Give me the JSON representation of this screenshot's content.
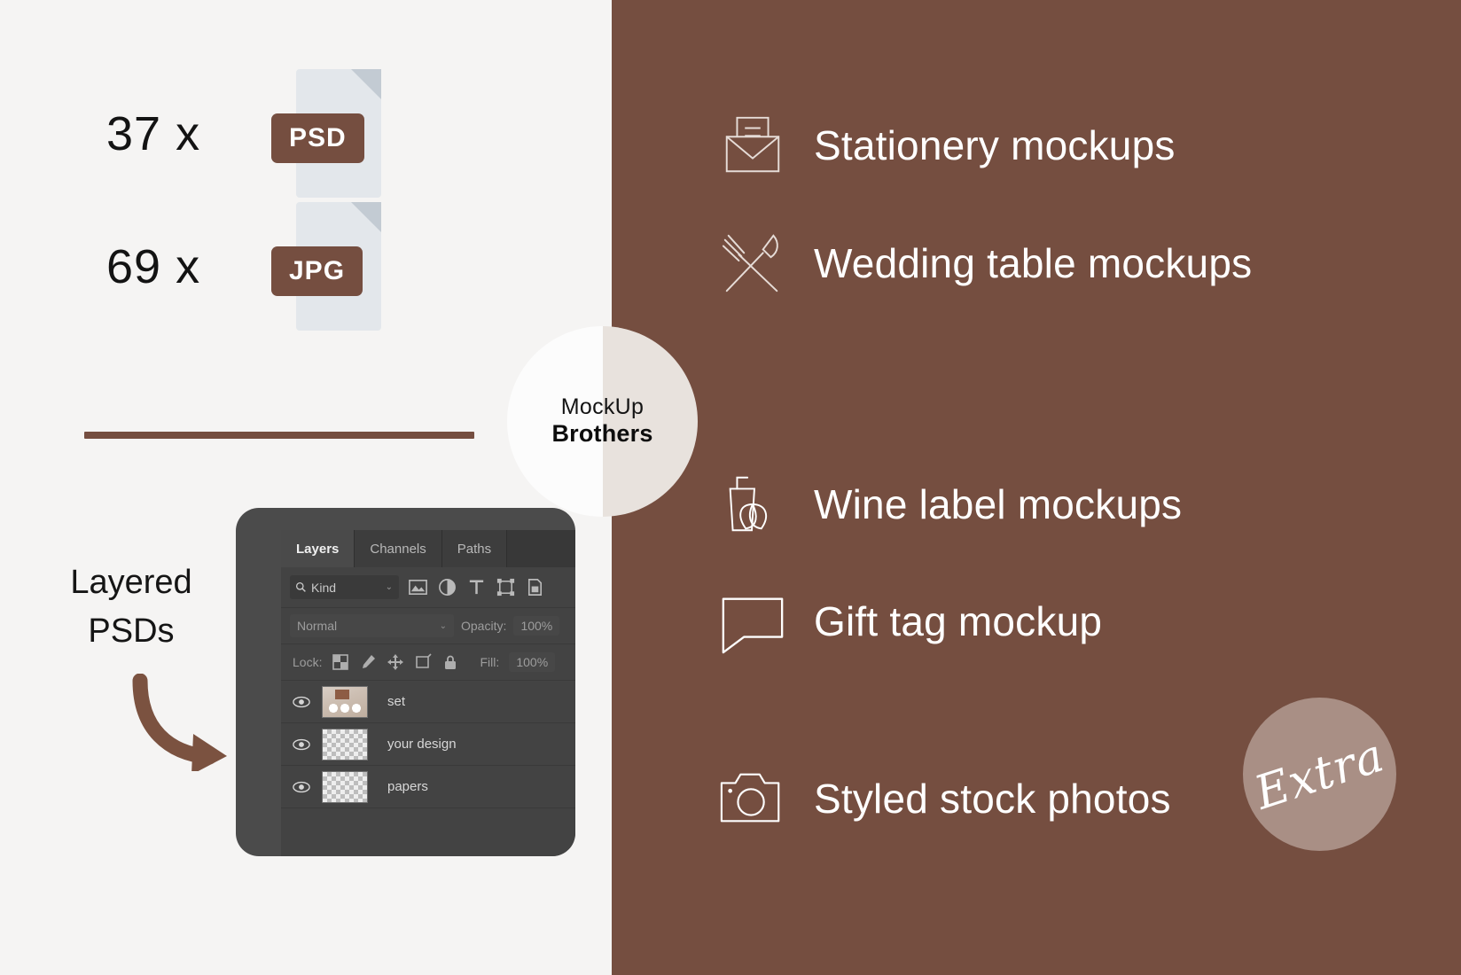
{
  "brand": {
    "line1": "MockUp",
    "line2": "Brothers"
  },
  "colors": {
    "brown": "#754e40",
    "panel_bg": "#f5f4f3",
    "badge_mauve": "#a98f85",
    "white": "#ffffff"
  },
  "left": {
    "file_types": [
      {
        "count": "37 x",
        "format": "PSD",
        "icon": "psd-file-icon"
      },
      {
        "count": "69 x",
        "format": "JPG",
        "icon": "jpg-file-icon"
      }
    ],
    "layered_label_line1": "Layered",
    "layered_label_line2": "PSDs",
    "arrow_icon": "curved-arrow-icon"
  },
  "photoshop": {
    "tabs": [
      {
        "label": "Layers",
        "active": true
      },
      {
        "label": "Channels",
        "active": false
      },
      {
        "label": "Paths",
        "active": false
      }
    ],
    "filter": {
      "kind_label": "Kind",
      "search_icon": "search-icon",
      "chevron": "⌄",
      "filter_icons": [
        "pixel-layer-filter-icon",
        "adjustment-layer-filter-icon",
        "type-layer-filter-icon",
        "shape-layer-filter-icon",
        "smart-object-filter-icon"
      ]
    },
    "blend": {
      "mode": "Normal",
      "chevron": "⌄",
      "opacity_label": "Opacity:",
      "opacity_value": "100%"
    },
    "lock": {
      "label": "Lock:",
      "icons": [
        "lock-transparent-pixels-icon",
        "lock-image-pixels-icon",
        "lock-position-icon",
        "lock-artboard-nesting-icon",
        "lock-all-icon"
      ],
      "fill_label": "Fill:",
      "fill_value": "100%"
    },
    "layers": [
      {
        "name": "set",
        "visible": true,
        "thumb": "image"
      },
      {
        "name": "your design",
        "visible": true,
        "thumb": "transparent"
      },
      {
        "name": "papers",
        "visible": true,
        "thumb": "transparent"
      }
    ],
    "eye_icon": "eye-visibility-icon"
  },
  "right": {
    "features": [
      {
        "label": "Stationery mockups",
        "icon": "envelope-icon"
      },
      {
        "label": "Wedding table mockups",
        "icon": "fork-knife-icon"
      },
      {
        "label": "Wine label mockups",
        "icon": "glass-leaf-icon"
      },
      {
        "label": "Gift tag mockup",
        "icon": "speech-tag-icon"
      },
      {
        "label": "Styled stock photos",
        "icon": "camera-icon"
      }
    ],
    "extra_badge": "Extra"
  }
}
